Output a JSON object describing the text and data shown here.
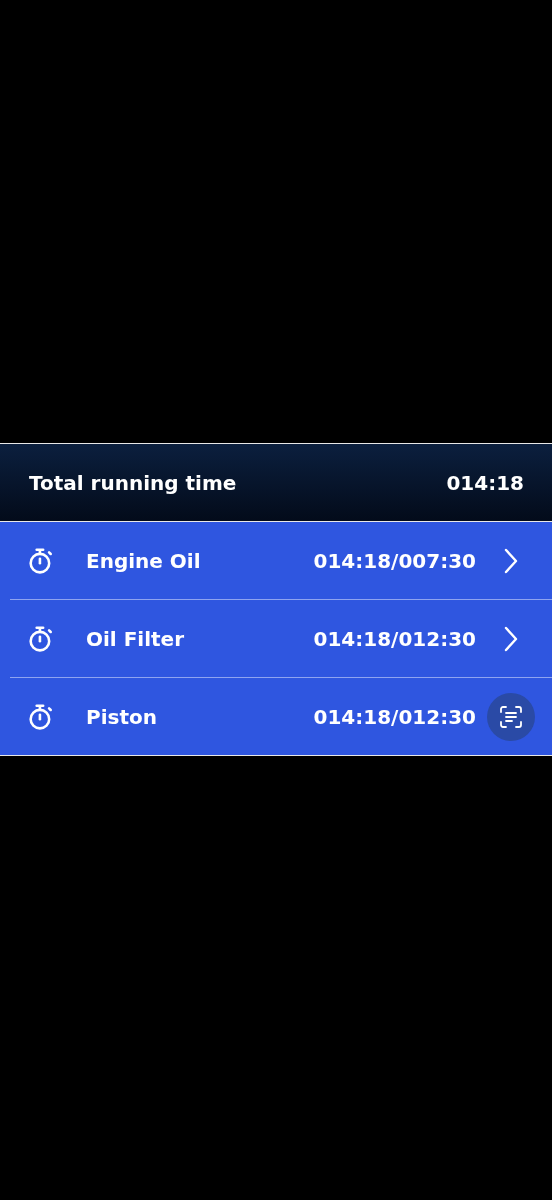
{
  "summary": {
    "label": "Total running time",
    "value": "014:18"
  },
  "items": [
    {
      "name": "Engine Oil",
      "reading": "014:18/007:30",
      "kind": "chevron"
    },
    {
      "name": "Oil Filter",
      "reading": "014:18/012:30",
      "kind": "chevron"
    },
    {
      "name": "Piston",
      "reading": "014:18/012:30",
      "kind": "scan"
    }
  ]
}
